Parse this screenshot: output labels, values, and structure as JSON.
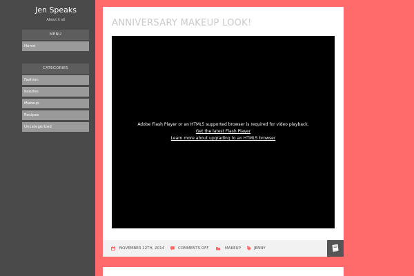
{
  "site": {
    "title": "Jen Speaks",
    "tagline": "About it all"
  },
  "menu": {
    "title": "MENU",
    "items": [
      {
        "label": "Home"
      }
    ]
  },
  "categories": {
    "title": "CATEGORIES",
    "items": [
      {
        "label": "Fashion"
      },
      {
        "label": "Koozies"
      },
      {
        "label": "Makeup"
      },
      {
        "label": "Recipes"
      },
      {
        "label": "Uncategorized"
      }
    ]
  },
  "post": {
    "title": "ANNIVERSARY MAKEUP LOOK!",
    "video": {
      "message": "Adobe Flash Player or an HTML5 supported browser is required for video playback.",
      "link_flash": "Get the latest Flash Player",
      "link_html5": "Learn more about upgrading to an HTML5 browser"
    },
    "meta": {
      "date": "NOVEMBER 12TH, 2014",
      "comments": "COMMENTS OFF",
      "category": "MAKEUP",
      "author": "JENNY"
    }
  },
  "colors": {
    "background": "#ff6b6b",
    "sidebar": "#4a4a4a",
    "accent": "#ff6b6b"
  },
  "icons": {
    "date": "calendar-icon",
    "comments": "comment-icon",
    "category": "folder-icon",
    "author": "tag-icon",
    "read_more": "book-icon"
  }
}
